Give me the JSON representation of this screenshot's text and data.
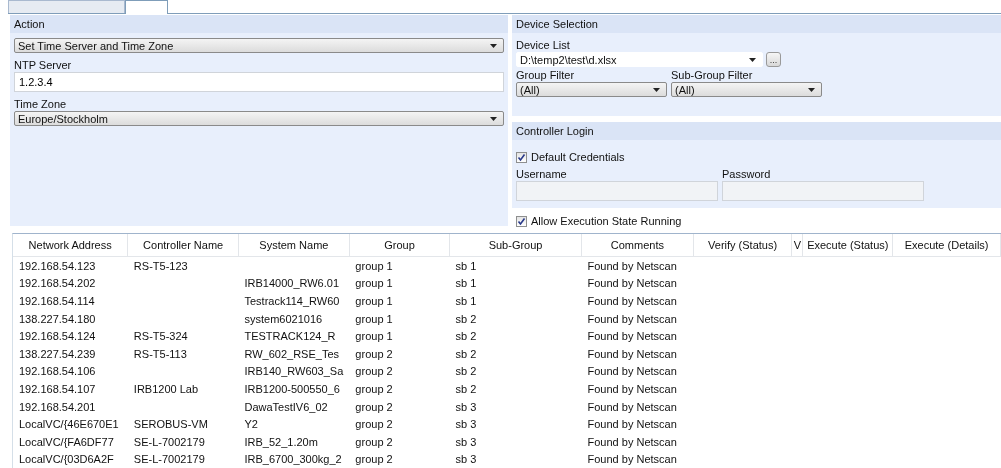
{
  "action_panel": {
    "title": "Action",
    "action": {
      "value": "Set Time Server and Time Zone"
    },
    "ntp_server": {
      "label": "NTP Server",
      "value": "1.2.3.4"
    },
    "time_zone": {
      "label": "Time Zone",
      "value": "Europe/Stockholm"
    }
  },
  "device_selection": {
    "title": "Device Selection",
    "device_list": {
      "label": "Device List",
      "value": "D:\\temp2\\test\\d.xlsx",
      "browse": "..."
    },
    "group_filter": {
      "label": "Group Filter",
      "value": "(All)"
    },
    "sub_group_filter": {
      "label": "Sub-Group Filter",
      "value": "(All)"
    }
  },
  "controller_login": {
    "title": "Controller Login",
    "default_credentials": {
      "label": "Default Credentials",
      "checked": true
    },
    "username": {
      "label": "Username"
    },
    "password": {
      "label": "Password"
    }
  },
  "allow_execution": {
    "label": "Allow Execution State Running",
    "checked": true
  },
  "table": {
    "columns": [
      "Network Address",
      "Controller Name",
      "System Name",
      "Group",
      "Sub-Group",
      "Comments",
      "Verify (Status)",
      "V",
      "Execute (Status)",
      "Execute (Details)"
    ],
    "rows": [
      [
        "192.168.54.123",
        "RS-T5-123",
        "",
        "group 1",
        "sb 1",
        "Found by Netscan"
      ],
      [
        "192.168.54.202",
        "",
        "IRB14000_RW6.01",
        "group 1",
        "sb 1",
        "Found by Netscan"
      ],
      [
        "192.168.54.114",
        "",
        "Testrack114_RW60",
        "group 1",
        "sb 1",
        "Found by Netscan"
      ],
      [
        "138.227.54.180",
        "",
        "system6021016",
        "group 1",
        "sb 2",
        "Found by Netscan"
      ],
      [
        "192.168.54.124",
        "RS-T5-324",
        "TESTRACK124_R",
        "group 1",
        "sb 2",
        "Found by Netscan"
      ],
      [
        "138.227.54.239",
        "RS-T5-113",
        "RW_602_RSE_Tes",
        "group 2",
        "sb 2",
        "Found by Netscan"
      ],
      [
        "192.168.54.106",
        "",
        "IRB140_RW603_Sa",
        "group 2",
        "sb 2",
        "Found by Netscan"
      ],
      [
        "192.168.54.107",
        "IRB1200 Lab",
        "IRB1200-500550_6",
        "group 2",
        "sb 2",
        "Found by Netscan"
      ],
      [
        "192.168.54.201",
        "",
        "DawaTestIV6_02",
        "group 2",
        "sb 3",
        "Found by Netscan"
      ],
      [
        "LocalVC/{46E670E1",
        "SEROBUS-VM",
        "Y2",
        "group 2",
        "sb 3",
        "Found by Netscan"
      ],
      [
        "LocalVC/{FA6DF77",
        "SE-L-7002179",
        "IRB_52_1.20m",
        "group 2",
        "sb 3",
        "Found by Netscan"
      ],
      [
        "LocalVC/{03D6A2F",
        "SE-L-7002179",
        "IRB_6700_300kg_2",
        "group 2",
        "sb 3",
        "Found by Netscan"
      ]
    ]
  }
}
